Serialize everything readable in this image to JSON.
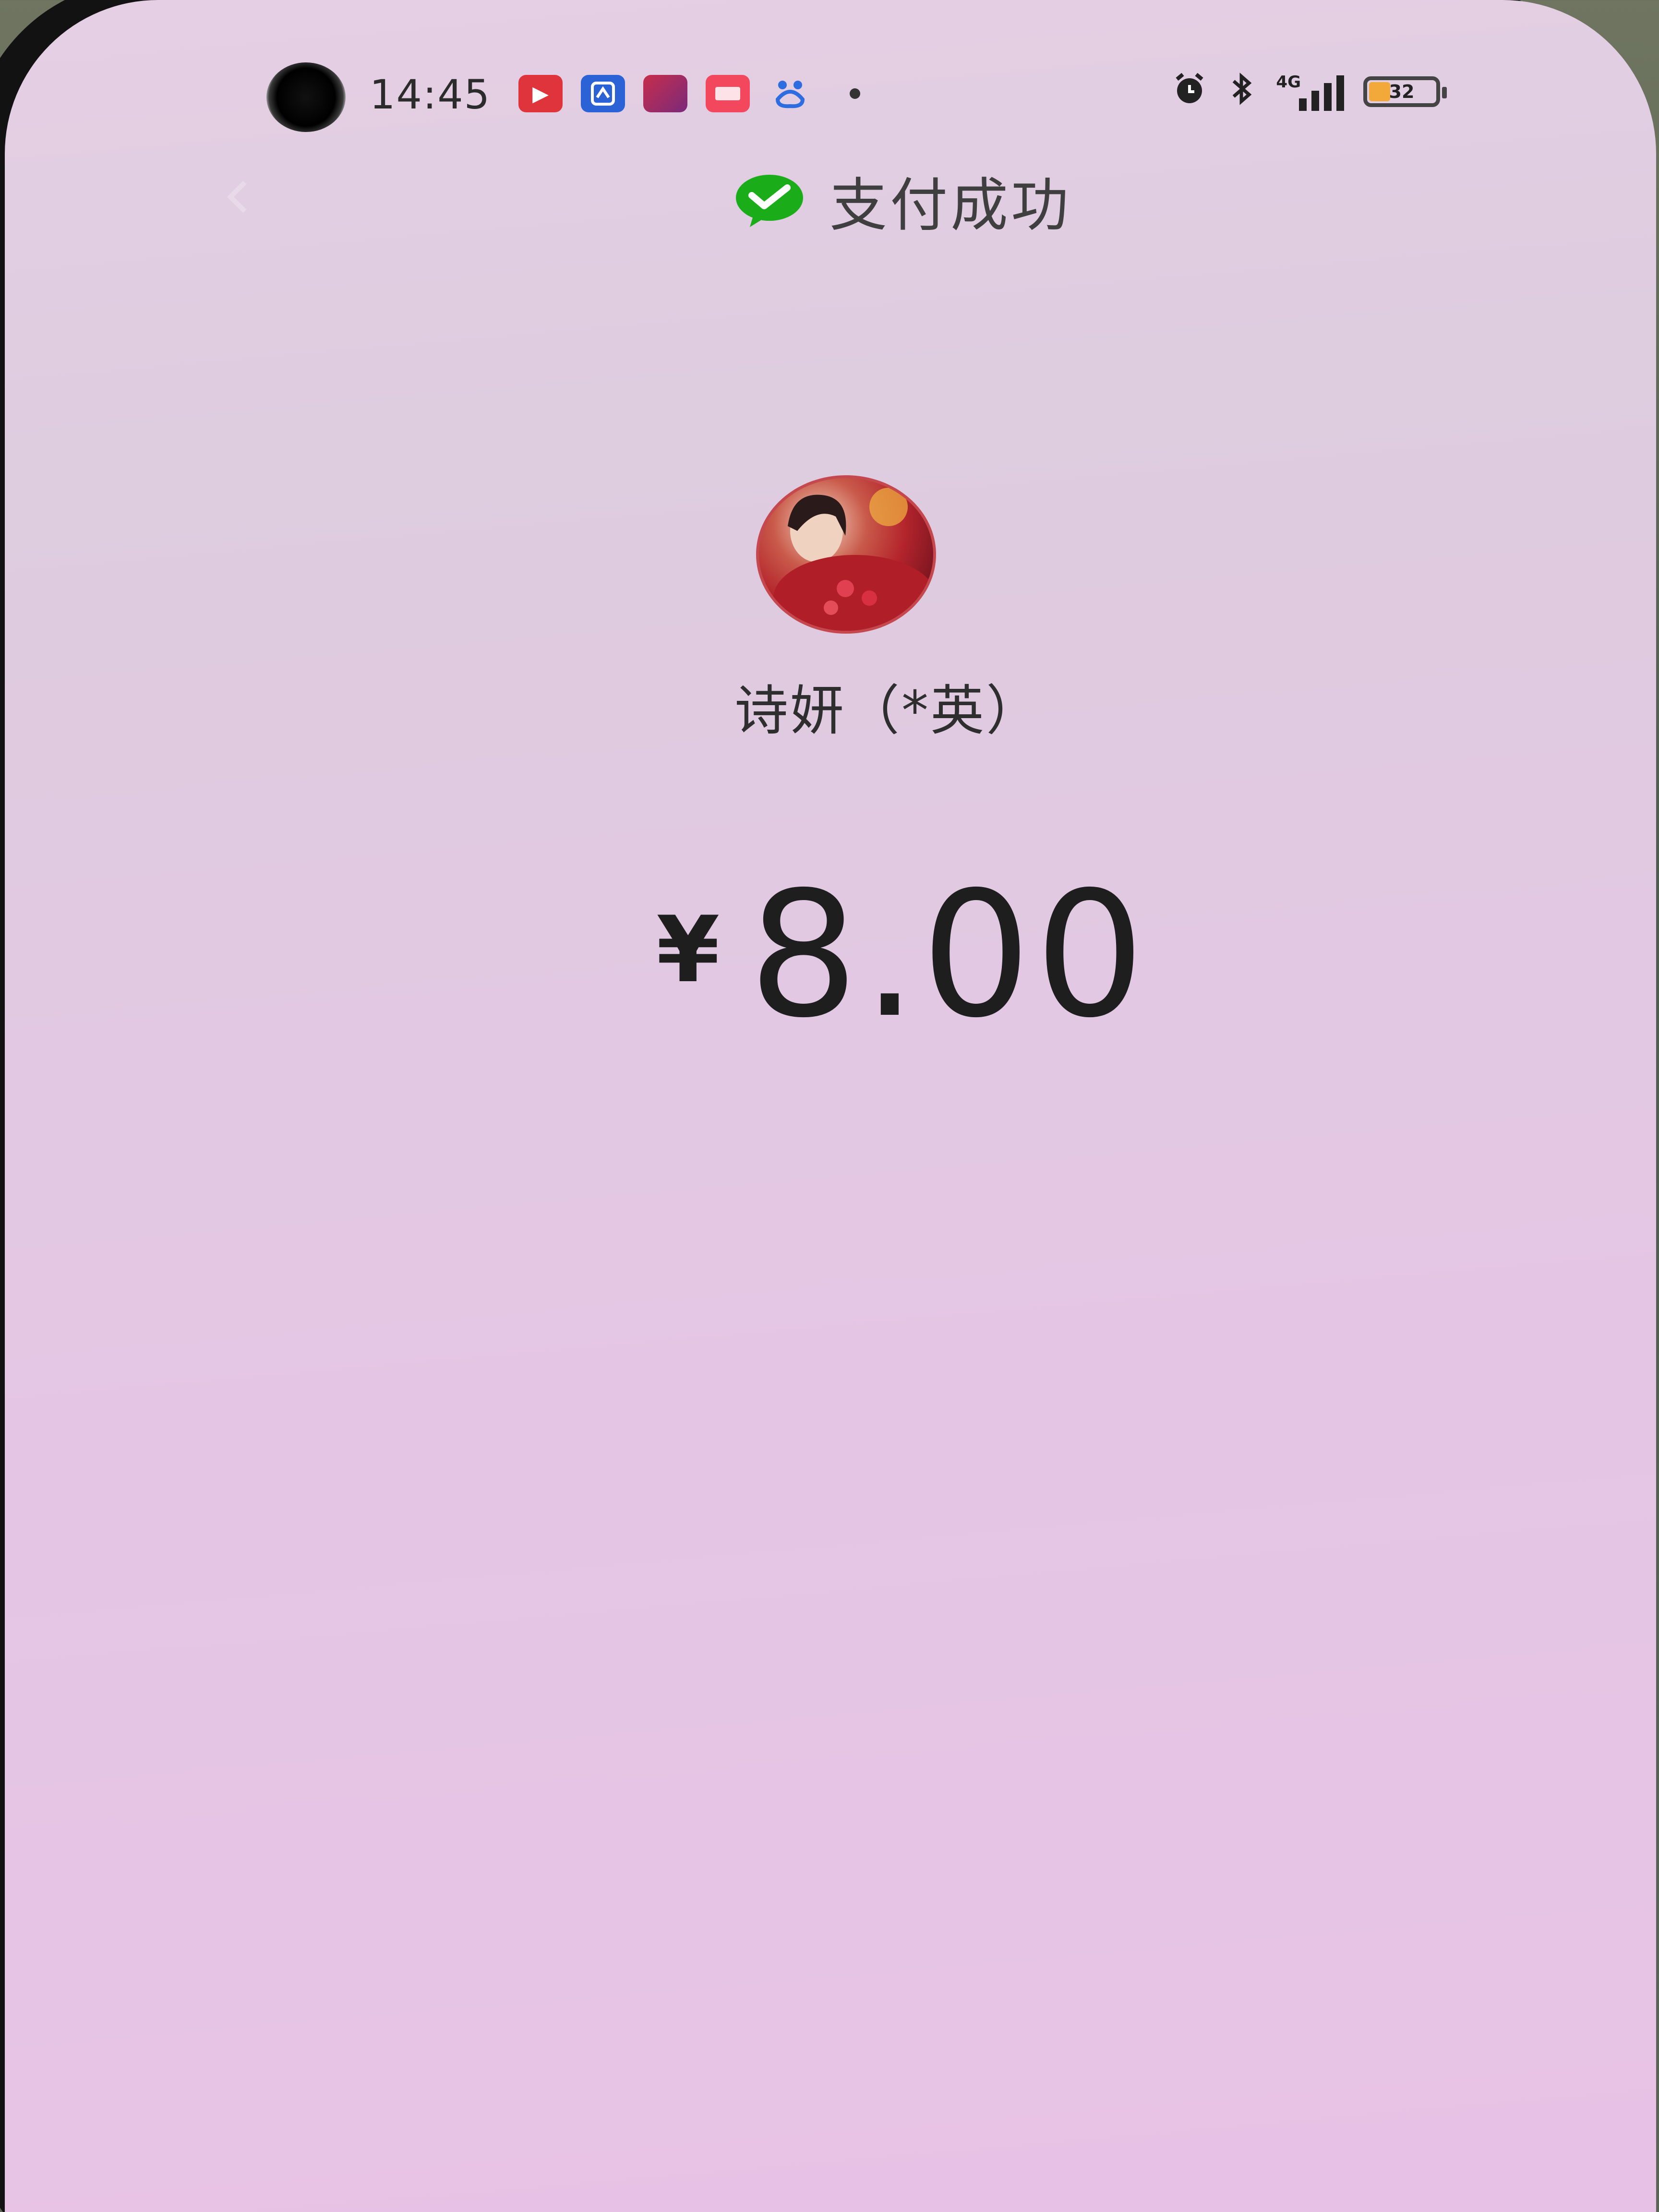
{
  "status_bar": {
    "time": "14:45",
    "notification_icons": [
      {
        "icon": "video-app-icon",
        "glyph": "▶",
        "color": "#e0343d"
      },
      {
        "icon": "baidu-app-icon",
        "glyph": "",
        "color": "#2b63d6"
      },
      {
        "icon": "gallery-app-icon",
        "glyph": "",
        "color": "#c72d4a"
      },
      {
        "icon": "news-app-icon",
        "glyph": "",
        "color": "#f2475c"
      },
      {
        "icon": "baidu-paw-icon",
        "glyph": "",
        "color": "#2e6de0"
      }
    ],
    "network_label": "4G",
    "battery_level": "32"
  },
  "header": {
    "title": "支付成功",
    "icon": "wechat-pay-check-icon",
    "accent_color": "#1aad19"
  },
  "payee": {
    "name": "诗妍（*英）"
  },
  "payment": {
    "currency": "¥",
    "amount": "8.00"
  }
}
